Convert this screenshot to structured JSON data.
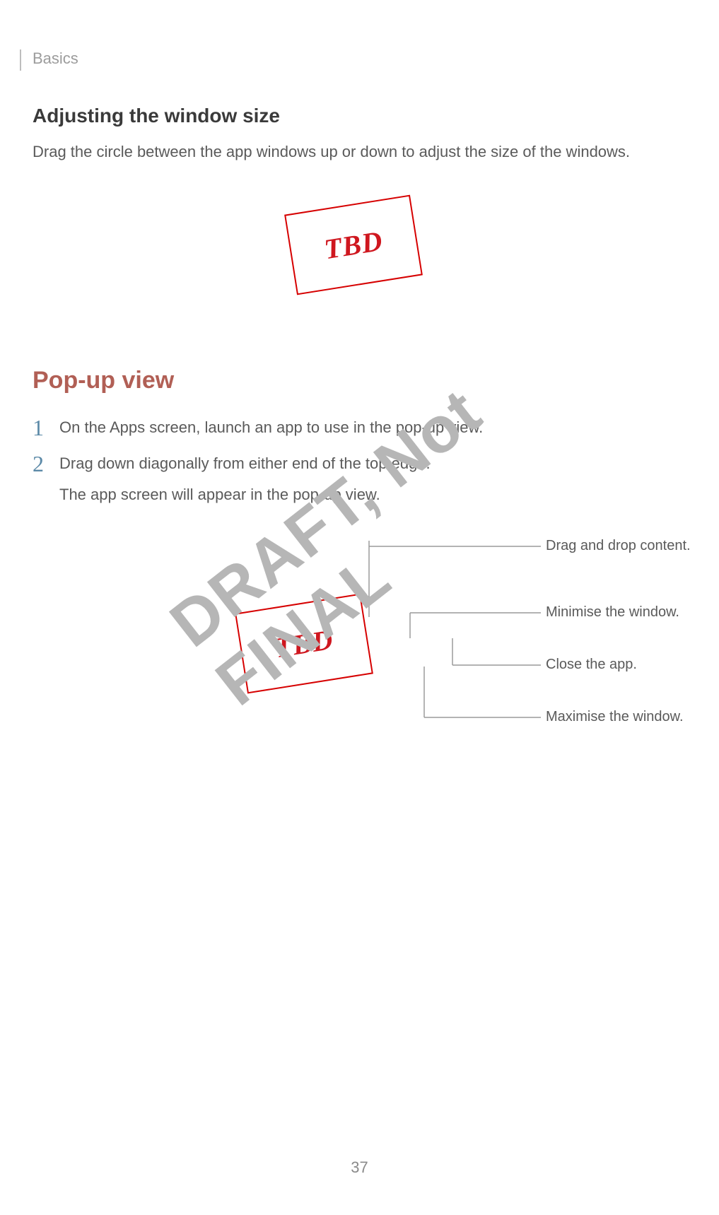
{
  "chapter": "Basics",
  "section1": {
    "heading": "Adjusting the window size",
    "body": "Drag the circle between the app windows up or down to adjust the size of the windows."
  },
  "tbd_label": "TBD",
  "section2": {
    "heading": "Pop-up view",
    "steps": [
      {
        "num": "1",
        "text": "On the Apps screen, launch an app to use in the pop-up view."
      },
      {
        "num": "2",
        "text": "Drag down diagonally from either end of the top edge.",
        "sub": "The app screen will appear in the pop-up view."
      }
    ],
    "callouts": {
      "drag": "Drag and drop content.",
      "minimise": "Minimise the window.",
      "close": "Close the app.",
      "maximise": "Maximise the window."
    }
  },
  "watermark": "DRAFT, Not FINAL",
  "page_number": "37"
}
